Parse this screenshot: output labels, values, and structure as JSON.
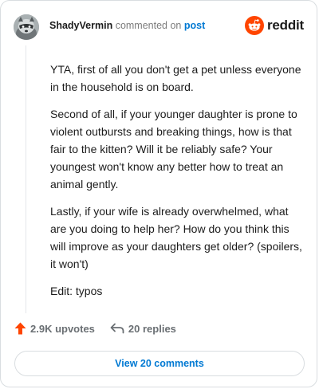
{
  "comment": {
    "username": "ShadyVermin",
    "action_text": "commented on",
    "post_link": "post",
    "paragraphs": [
      "YTA, first of all you don't get a pet unless everyone in the household is on board.",
      "Second of all, if your younger daughter is prone to violent outbursts and breaking things, how is that fair to the kitten? Will it be reliably safe? Your youngest won't know any better how to treat an animal gently.",
      "Lastly, if your wife is already overwhelmed, what are you doing to help her? How do you think this will improve as your daughters get older? (spoilers, it won't)",
      "Edit: typos"
    ]
  },
  "brand": {
    "wordmark": "reddit",
    "icon": "reddit-snoo-icon",
    "color": "#ff4500"
  },
  "actions": {
    "upvotes_label": "2.9K upvotes",
    "upvote_icon": "upvote-arrow-icon",
    "upvote_color": "#ff4500",
    "replies_label": "20 replies",
    "reply_icon": "reply-arrow-icon"
  },
  "footer": {
    "view_comments_label": "View 20 comments",
    "link_color": "#0079d3"
  }
}
